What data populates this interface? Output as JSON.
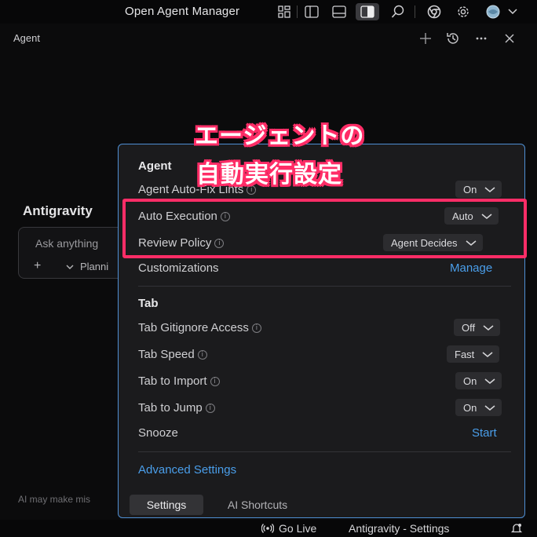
{
  "topbar": {
    "title": "Open Agent Manager",
    "icons": [
      "layout-grid-icon",
      "sidebar-left-icon",
      "panel-bottom-icon",
      "sidebar-right-icon",
      "search-icon",
      "chrome-icon",
      "gear-icon",
      "avatar-icon"
    ]
  },
  "agent_panel": {
    "label": "Agent",
    "background_title": "Antigravity",
    "input_placeholder": "Ask anything",
    "plus_label": "+",
    "mode_label": "Planni",
    "disclaimer": "AI may make mis"
  },
  "annotation": {
    "line1": "エージェントの",
    "line2": "自動実行設定",
    "color": "#ff2d67"
  },
  "settings": {
    "agent_section": {
      "title": "Agent",
      "rows": [
        {
          "label": "Agent Auto-Fix Lints",
          "value": "On"
        },
        {
          "label": "Auto Execution",
          "value": "Auto"
        },
        {
          "label": "Review Policy",
          "value": "Agent Decides"
        }
      ],
      "customizations_label": "Customizations",
      "manage_link": "Manage"
    },
    "tab_section": {
      "title": "Tab",
      "rows": [
        {
          "label": "Tab Gitignore Access",
          "value": "Off"
        },
        {
          "label": "Tab Speed",
          "value": "Fast"
        },
        {
          "label": "Tab to Import",
          "value": "On"
        },
        {
          "label": "Tab to Jump",
          "value": "On"
        }
      ],
      "snooze_label": "Snooze",
      "start_link": "Start"
    },
    "advanced_link": "Advanced Settings",
    "footer_tabs": {
      "settings": "Settings",
      "shortcuts": "AI Shortcuts"
    }
  },
  "statusbar": {
    "go_live": "Go Live",
    "window_label": "Antigravity - Settings"
  },
  "colors": {
    "accent": "#4a9eea",
    "border": "#4f8fd4",
    "highlight": "#ff2d67"
  }
}
